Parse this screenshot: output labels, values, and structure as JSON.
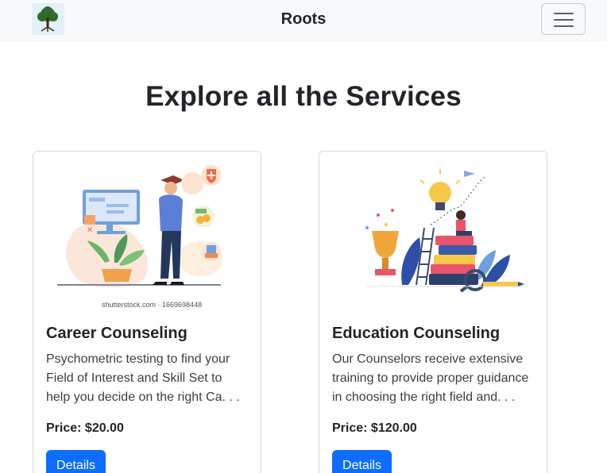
{
  "navbar": {
    "brand": "Roots",
    "logo_icon": "tree-logo-icon",
    "toggler_icon": "hamburger-menu-icon"
  },
  "page": {
    "heading": "Explore all the Services"
  },
  "services": [
    {
      "title": "Career Counseling",
      "description": "Psychometric testing to find your Field of Interest and Skill Set to help you decide on the right Ca. . .",
      "price": "Price: $20.00",
      "button": "Details",
      "image_caption": "shutterstock.com · 1669698448"
    },
    {
      "title": "Education Counseling",
      "description": "Our Counselors receive extensive training to provide proper guidance in choosing the right field and. . .",
      "price": "Price: $120.00",
      "button": "Details"
    }
  ],
  "colors": {
    "primary": "#0d6efd",
    "navbar_bg": "#f8f9fa",
    "text": "#212529"
  }
}
